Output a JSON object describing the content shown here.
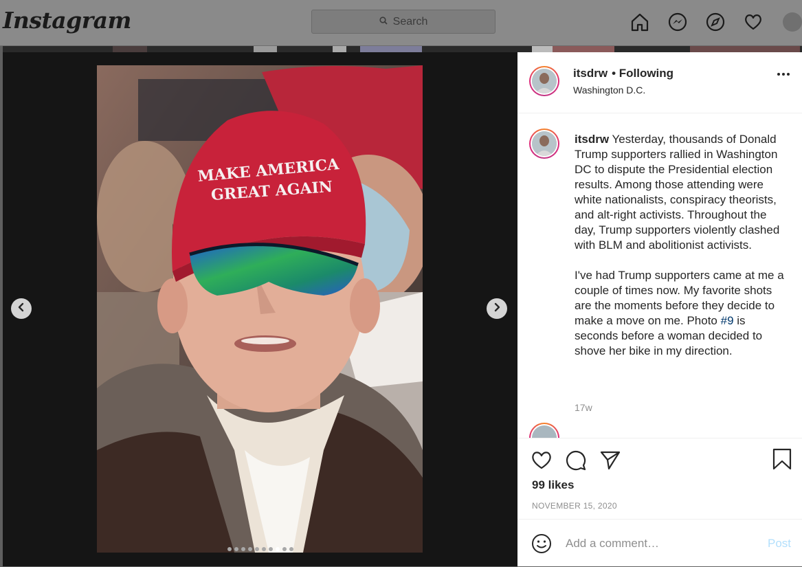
{
  "topnav": {
    "logo": "Instagram",
    "search_placeholder": "Search"
  },
  "post": {
    "username": "itsdrw",
    "follow_status": "• Following",
    "location": "Washington D.C.",
    "caption": {
      "username": "itsdrw",
      "paragraph1": "Yesterday, thousands of Donald Trump supporters rallied in Washington DC to dispute the Presidential election results. Among those attending were white nationalists, conspiracy theorists, and alt-right activists. Throughout the day, Trump supporters violently clashed with BLM and abolitionist activists.",
      "paragraph2_before_tag": "I've had Trump supporters came at me a couple of times now. My favorite shots are the moments before they decide to make a move on me. Photo",
      "tag": "#9",
      "paragraph2_after_tag": "is seconds before a woman decided to shove her bike in my direction."
    },
    "time_ago": "17w",
    "likes": "99 likes",
    "date": "NOVEMBER 15, 2020",
    "carousel": {
      "total": 10,
      "active_index": 7
    },
    "photo_text": {
      "hat_line1": "MAKE AMERICA",
      "hat_line2": "GREAT AGAIN"
    }
  },
  "comment_box": {
    "placeholder": "Add a comment…",
    "post_label": "Post"
  },
  "colors": {
    "accent_link": "#00376b",
    "post_button_disabled": "#b2dffc",
    "hat_red": "#c8223a"
  },
  "icons": [
    "home-icon",
    "messenger-icon",
    "explore-icon",
    "heart-icon",
    "search-icon",
    "chevron-left-icon",
    "chevron-right-icon",
    "more-icon",
    "like-icon",
    "comment-icon",
    "share-icon",
    "save-icon",
    "emoji-icon"
  ]
}
